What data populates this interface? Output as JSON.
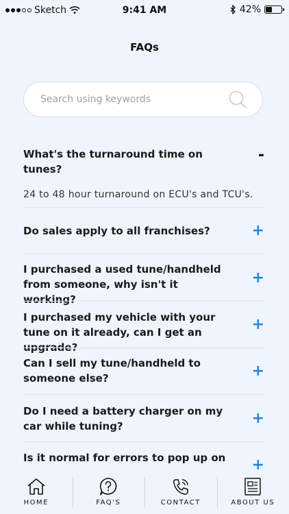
{
  "status": {
    "carrier": "Sketch",
    "time": "9:41 AM",
    "battery": "42%"
  },
  "page": {
    "title": "FAQs"
  },
  "search": {
    "placeholder": "Search using keywords",
    "value": ""
  },
  "faqs": [
    {
      "q": "What's the turnaround time on tunes?",
      "toggle": "-",
      "expanded": true,
      "a": "24 to 48 hour turnaround on ECU's and TCU's."
    },
    {
      "q": "Do sales apply to all franchises?",
      "toggle": "+"
    },
    {
      "q": "I purchased a used tune/handheld from someone, why isn't it working?",
      "toggle": "+"
    },
    {
      "q": "I purchased my vehicle with your tune on it already, can I get an upgrade?",
      "toggle": "+"
    },
    {
      "q": "Can I sell my tune/handheld to someone else?",
      "toggle": "+"
    },
    {
      "q": "Do I need a battery charger on my car while tuning?",
      "toggle": "+"
    },
    {
      "q": "Is it normal for errors to pop up on",
      "toggle": "+"
    }
  ],
  "tabs": [
    {
      "label": "HOME",
      "icon": "home-icon"
    },
    {
      "label": "FAQ'S",
      "icon": "question-icon"
    },
    {
      "label": "CONTACT",
      "icon": "phone-icon"
    },
    {
      "label": "ABOUT US",
      "icon": "news-icon"
    }
  ],
  "colors": {
    "accent": "#1e88e5",
    "background": "#f0f4fc"
  }
}
